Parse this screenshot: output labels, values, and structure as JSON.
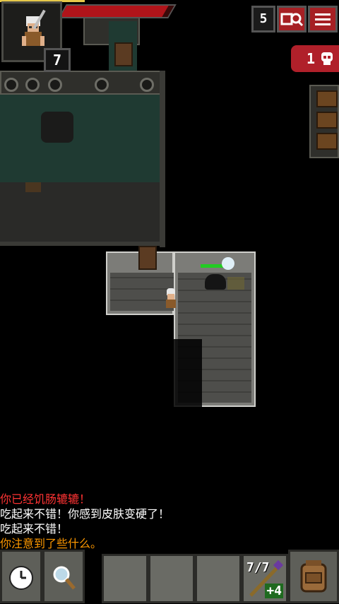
{
  "hud": {
    "hero_level": "7",
    "depth": "5",
    "danger_count": "1",
    "health_fraction": 0.95,
    "icons": {
      "journal": "journal-search-icon",
      "menu": "menu-icon",
      "danger": "skull-icon",
      "portrait": "hero-huntress-icon"
    }
  },
  "log": {
    "lines": [
      {
        "text": "你已经饥肠辘辘！",
        "color": "#ff3333"
      },
      {
        "text": "吃起来不错！你感到皮肤变硬了！",
        "color": "#ffffff"
      },
      {
        "text": "吃起来不错！",
        "color": "#ffffff"
      },
      {
        "text": "你注意到了些什么。",
        "color": "#ff9900"
      }
    ]
  },
  "toolbar": {
    "wait_icon": "clock-icon",
    "search_icon": "magnifier-icon",
    "quickslot_charges": "7/7",
    "quickslot_upgrade": "+4",
    "quickslot_item_icon": "wand-icon",
    "backpack_icon": "backpack-icon"
  },
  "colors": {
    "accent_red": "#a62024",
    "danger_red": "#b0202a",
    "hp_red": "#b0141a"
  }
}
